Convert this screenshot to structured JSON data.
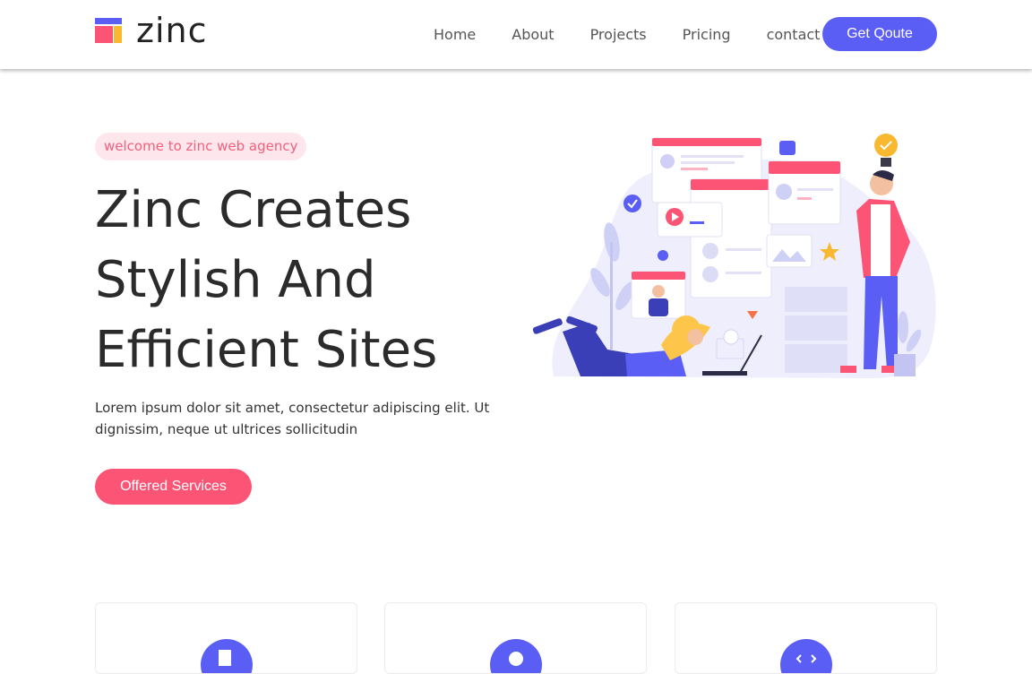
{
  "brand": {
    "name": "zinc",
    "colors": {
      "primary": "#5b5ef4",
      "accent": "#fc5475",
      "yellow": "#f8b930",
      "tag_bg": "#fde7ec",
      "tag_text": "#f25f7c"
    }
  },
  "nav": {
    "items": [
      {
        "label": "Home"
      },
      {
        "label": "About"
      },
      {
        "label": "Projects"
      },
      {
        "label": "Pricing"
      },
      {
        "label": "contact"
      }
    ],
    "cta_label": "Get Qoute"
  },
  "hero": {
    "tagline": "welcome to zinc web agency",
    "title_lines": [
      "Zinc Creates",
      "Stylish And",
      "Efficient Sites"
    ],
    "description": "Lorem ipsum dolor sit amet, consectetur adipiscing elit. Ut dignissim, neque ut ultrices sollicitudin",
    "button_label": "Offered Services"
  },
  "services": {
    "cards": [
      {
        "icon": "document-icon"
      },
      {
        "icon": "chat-icon"
      },
      {
        "icon": "code-icon"
      }
    ]
  }
}
